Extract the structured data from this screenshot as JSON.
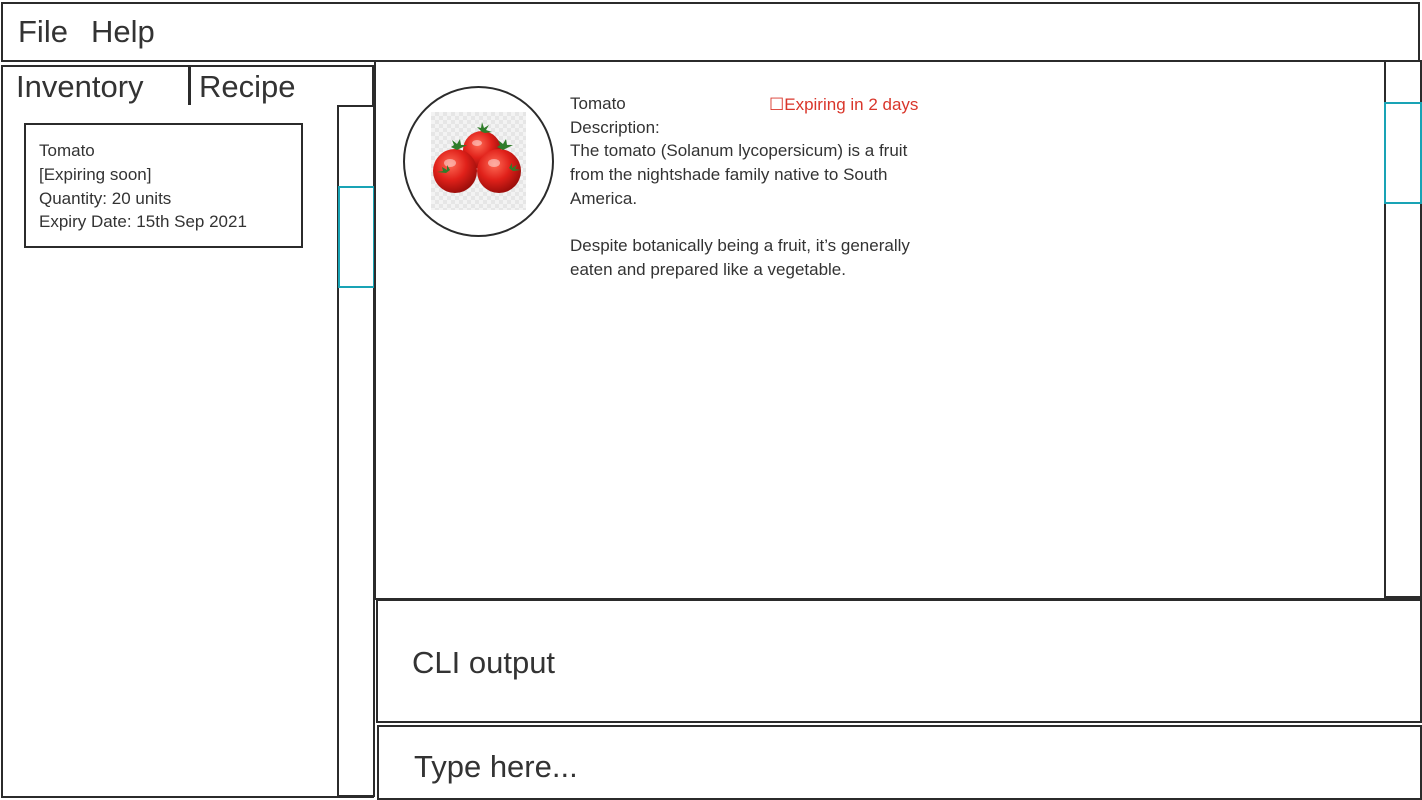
{
  "menu": {
    "file": "File",
    "help": "Help"
  },
  "tabs": {
    "inventory": "Inventory",
    "recipe": "Recipe"
  },
  "inventory_list": [
    {
      "name": "Tomato",
      "status": "[Expiring soon]",
      "quantity": "Quantity: 20 units",
      "expiry_date": "Expiry Date: 15th Sep 2021"
    }
  ],
  "detail": {
    "name": "Tomato",
    "expiry_warning": "☐Expiring in 2 days",
    "description_label": "Description:",
    "description_lines": [
      "The tomato (Solanum lycopersicum) is a fruit",
      "from the nightshade family native to South",
      "America.",
      "Despite botanically being a fruit, it’s generally",
      "eaten and prepared like a vegetable."
    ],
    "image_icon": "tomato-image"
  },
  "cli": {
    "output_label": "CLI output"
  },
  "command": {
    "placeholder": "Type here..."
  },
  "colors": {
    "accent": "#19a3b5",
    "warning": "#d9362b",
    "border": "#2b2b2b",
    "text": "#333333"
  }
}
